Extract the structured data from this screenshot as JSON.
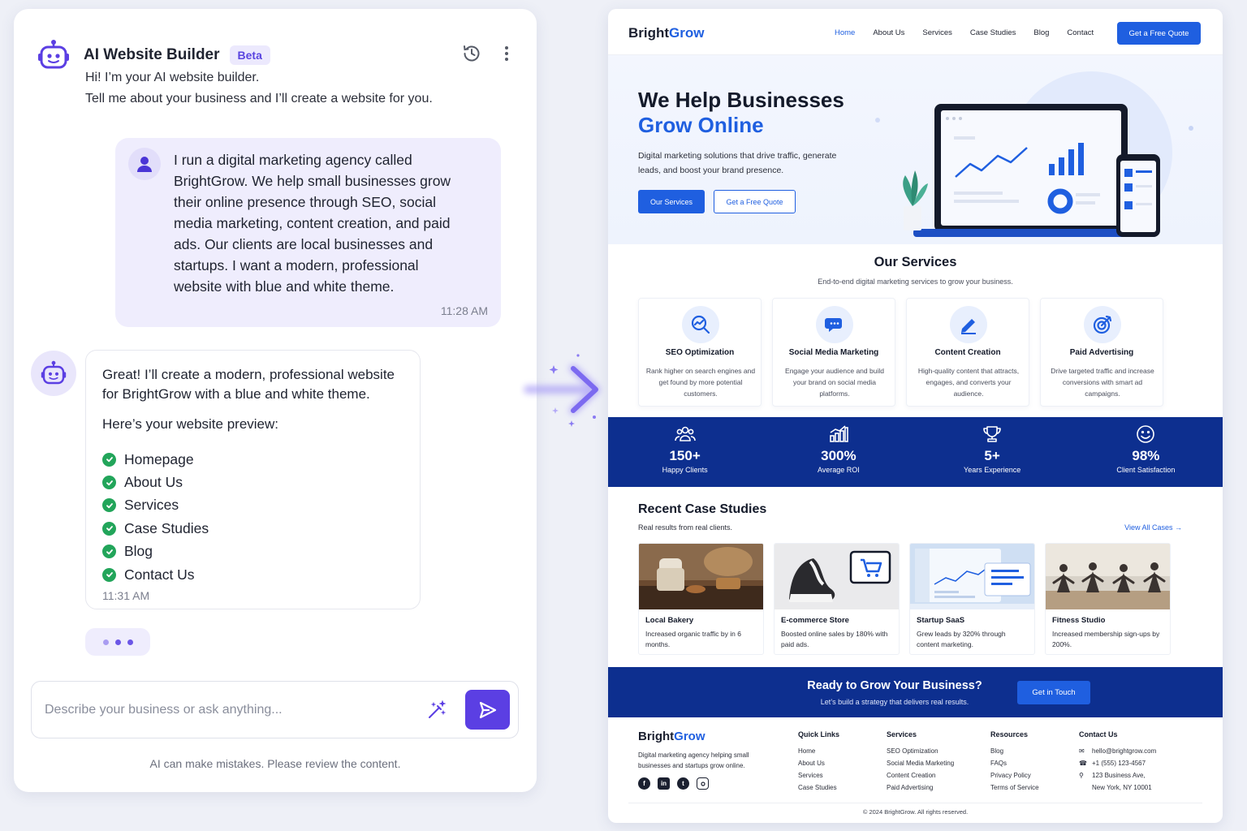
{
  "chat": {
    "title": "AI Website Builder",
    "badge": "Beta",
    "intro_line1": "Hi! I’m your AI website builder.",
    "intro_line2": "Tell me about your business and I’ll create a website for you.",
    "user_message": "I run a digital marketing agency called BrightGrow. We help small businesses grow their online presence through SEO, social media marketing, content creation, and paid ads. Our clients are local businesses and startups. I want a modern, professional website with blue and white theme.",
    "user_time": "11:28 AM",
    "bot_message": "Great! I’ll create a modern, professional website for BrightGrow with a blue and white theme.",
    "bot_preview_label": "Here’s your website preview:",
    "checklist": [
      "Homepage",
      "About Us",
      "Services",
      "Case Studies",
      "Blog",
      "Contact Us"
    ],
    "bot_time": "11:31 AM",
    "input_placeholder": "Describe your business or ask anything...",
    "disclaimer": "AI can make mistakes. Please review the content."
  },
  "site": {
    "brand_a": "Bright",
    "brand_b": "Grow",
    "nav": [
      "Home",
      "About Us",
      "Services",
      "Case Studies",
      "Blog",
      "Contact"
    ],
    "nav_cta": "Get a Free Quote",
    "hero": {
      "title_line1": "We Help Businesses",
      "title_line2": "Grow Online",
      "subtitle": "Digital marketing solutions that drive traffic, generate leads, and boost your brand presence.",
      "btn_primary": "Our Services",
      "btn_secondary": "Get a Free Quote"
    },
    "services": {
      "title": "Our Services",
      "subtitle": "End-to-end digital marketing services to grow your business.",
      "items": [
        {
          "icon": "seo-search-icon",
          "name": "SEO Optimization",
          "desc": "Rank higher on search engines and get found by more potential customers."
        },
        {
          "icon": "chat-bubbles-icon",
          "name": "Social Media Marketing",
          "desc": "Engage your audience and build your brand on social media platforms."
        },
        {
          "icon": "pencil-edit-icon",
          "name": "Content Creation",
          "desc": "High-quality content that attracts, engages, and converts your audience."
        },
        {
          "icon": "target-icon",
          "name": "Paid Advertising",
          "desc": "Drive targeted traffic and increase conversions with smart ad campaigns."
        }
      ]
    },
    "stats": [
      {
        "icon": "users-icon",
        "value": "150+",
        "label": "Happy Clients"
      },
      {
        "icon": "bar-chart-icon",
        "value": "300%",
        "label": "Average ROI"
      },
      {
        "icon": "trophy-icon",
        "value": "5+",
        "label": "Years Experience"
      },
      {
        "icon": "smile-icon",
        "value": "98%",
        "label": "Client Satisfaction"
      }
    ],
    "cases": {
      "title": "Recent Case Studies",
      "subtitle": "Real results from real clients.",
      "view_all": "View All Cases →",
      "items": [
        {
          "name": "Local Bakery",
          "desc": "Increased organic traffic by in 6 months."
        },
        {
          "name": "E-commerce Store",
          "desc": "Boosted online sales by 180% with paid ads."
        },
        {
          "name": "Startup SaaS",
          "desc": "Grew leads by 320% through content marketing."
        },
        {
          "name": "Fitness Studio",
          "desc": "Increased membership sign-ups by 200%."
        }
      ]
    },
    "cta": {
      "title": "Ready to Grow Your Business?",
      "subtitle": "Let’s build a strategy that delivers real results.",
      "button": "Get in Touch"
    },
    "footer": {
      "desc": "Digital marketing agency helping small businesses and startups grow online.",
      "quick_links_title": "Quick Links",
      "quick_links": [
        "Home",
        "About Us",
        "Services",
        "Case Studies"
      ],
      "services_title": "Services",
      "services": [
        "SEO Optimization",
        "Social Media Marketing",
        "Content Creation",
        "Paid Advertising"
      ],
      "resources_title": "Resources",
      "resources": [
        "Blog",
        "FAQs",
        "Privacy Policy",
        "Terms of Service"
      ],
      "contact_title": "Contact Us",
      "email": "hello@brightgrow.com",
      "phone": "+1 (555) 123-4567",
      "address_line1": "123 Business Ave,",
      "address_line2": "New York, NY 10001",
      "copyright": "© 2024 BrightGrow. All rights reserved."
    }
  },
  "colors": {
    "accent_purple": "#5b3fe3",
    "brand_blue": "#1f5fe0",
    "navy_band": "#0d2f8f",
    "check_green": "#22a55a"
  }
}
